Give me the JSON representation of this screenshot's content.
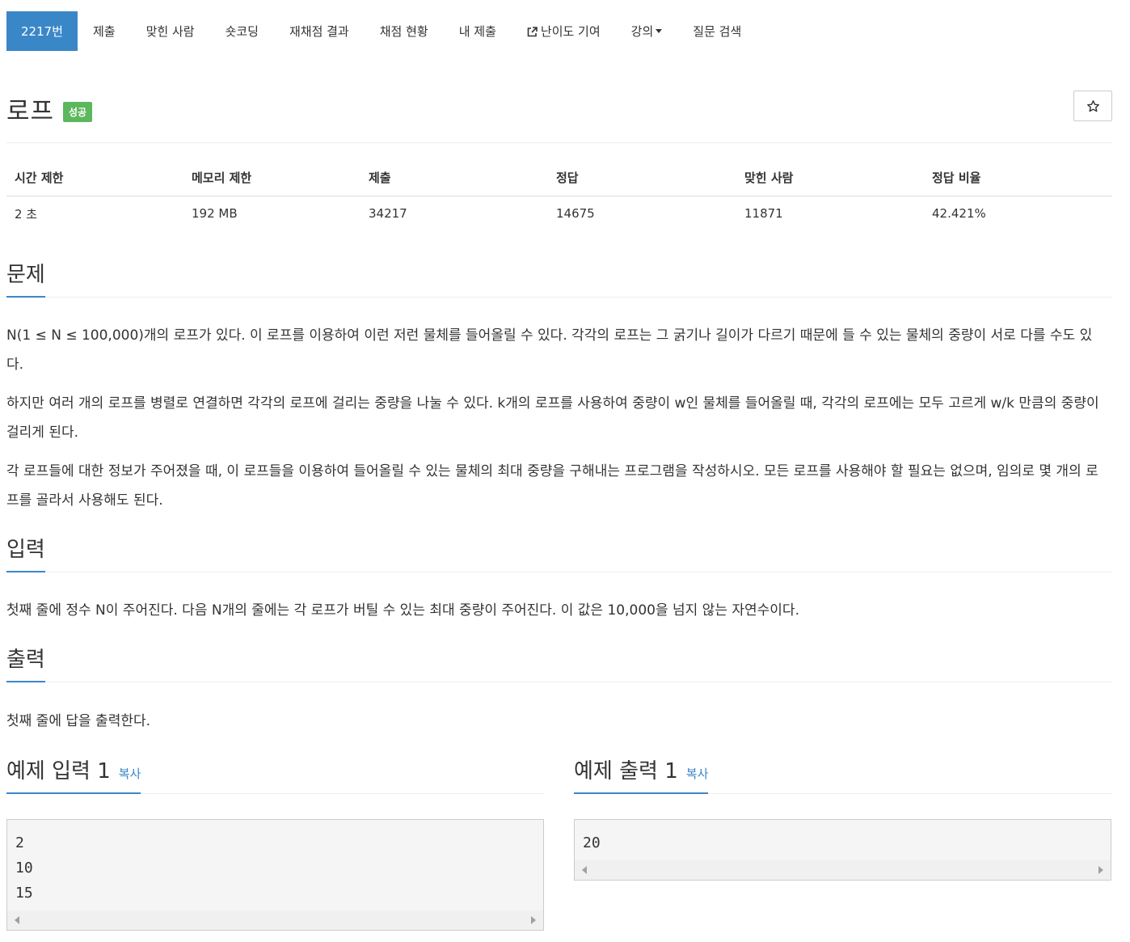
{
  "nav": {
    "items": [
      {
        "label": "2217번",
        "active": true
      },
      {
        "label": "제출"
      },
      {
        "label": "맞힌 사람"
      },
      {
        "label": "숏코딩"
      },
      {
        "label": "재채점 결과"
      },
      {
        "label": "채점 현황"
      },
      {
        "label": "내 제출"
      },
      {
        "label": "난이도 기여",
        "icon": "external-link-icon"
      },
      {
        "label": "강의",
        "icon": "caret-down-icon"
      },
      {
        "label": "질문 검색"
      }
    ]
  },
  "problem": {
    "title": "로프",
    "badge": "성공",
    "star_icon": "star-outline-icon"
  },
  "info": {
    "headers": [
      "시간 제한",
      "메모리 제한",
      "제출",
      "정답",
      "맞힌 사람",
      "정답 비율"
    ],
    "values": [
      "2 초",
      "192 MB",
      "34217",
      "14675",
      "11871",
      "42.421%"
    ]
  },
  "sections": {
    "description": {
      "title": "문제",
      "paragraphs": [
        "N(1 ≤ N ≤ 100,000)개의 로프가 있다. 이 로프를 이용하여 이런 저런 물체를 들어올릴 수 있다. 각각의 로프는 그 굵기나 길이가 다르기 때문에 들 수 있는 물체의 중량이 서로 다를 수도 있다.",
        "하지만 여러 개의 로프를 병렬로 연결하면 각각의 로프에 걸리는 중량을 나눌 수 있다. k개의 로프를 사용하여 중량이 w인 물체를 들어올릴 때, 각각의 로프에는 모두 고르게 w/k 만큼의 중량이 걸리게 된다.",
        "각 로프들에 대한 정보가 주어졌을 때, 이 로프들을 이용하여 들어올릴 수 있는 물체의 최대 중량을 구해내는 프로그램을 작성하시오. 모든 로프를 사용해야 할 필요는 없으며, 임의로 몇 개의 로프를 골라서 사용해도 된다."
      ]
    },
    "input": {
      "title": "입력",
      "text": "첫째 줄에 정수 N이 주어진다. 다음 N개의 줄에는 각 로프가 버틸 수 있는 최대 중량이 주어진다. 이 값은 10,000을 넘지 않는 자연수이다."
    },
    "output": {
      "title": "출력",
      "text": "첫째 줄에 답을 출력한다."
    }
  },
  "samples": {
    "input": {
      "title": "예제 입력 1",
      "copy_label": "복사",
      "content": "2\n10\n15"
    },
    "output": {
      "title": "예제 출력 1",
      "copy_label": "복사",
      "content": "20"
    }
  },
  "colors": {
    "accent": "#3a87c8",
    "success": "#5cb85c"
  }
}
